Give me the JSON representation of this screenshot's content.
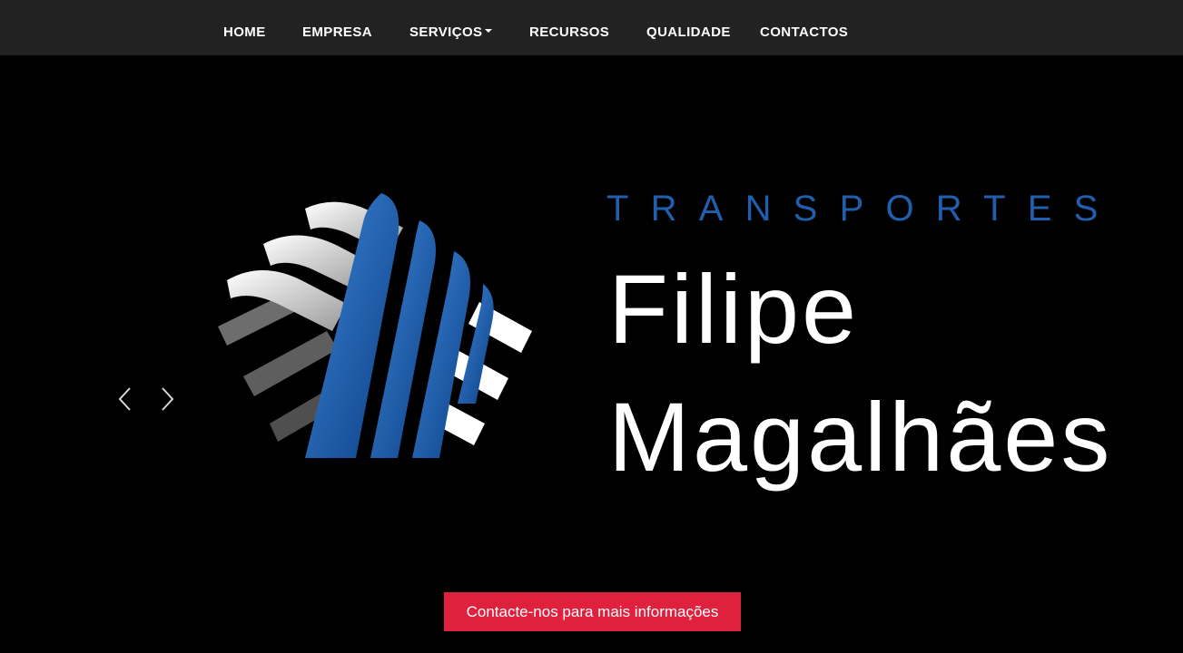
{
  "nav": {
    "items": [
      {
        "label": "HOME"
      },
      {
        "label": "EMPRESA"
      },
      {
        "label": "SERVIÇOS",
        "has_dropdown": true
      },
      {
        "label": "RECURSOS"
      },
      {
        "label": "QUALIDADE"
      },
      {
        "label": "CONTACTOS"
      }
    ]
  },
  "hero": {
    "brand_top": "TRANSPORTES",
    "brand_line1": "Filipe",
    "brand_line2": "Magalhães",
    "logo_icon": "striped-cube-logo",
    "prev_icon": "chevron-left-icon",
    "next_icon": "chevron-right-icon"
  },
  "cta": {
    "label": "Contacte-nos para mais informações"
  },
  "colors": {
    "navbar_bg": "#222222",
    "hero_bg": "#000000",
    "brand_blue": "#1f5fae",
    "cta_red": "#e0213d"
  }
}
